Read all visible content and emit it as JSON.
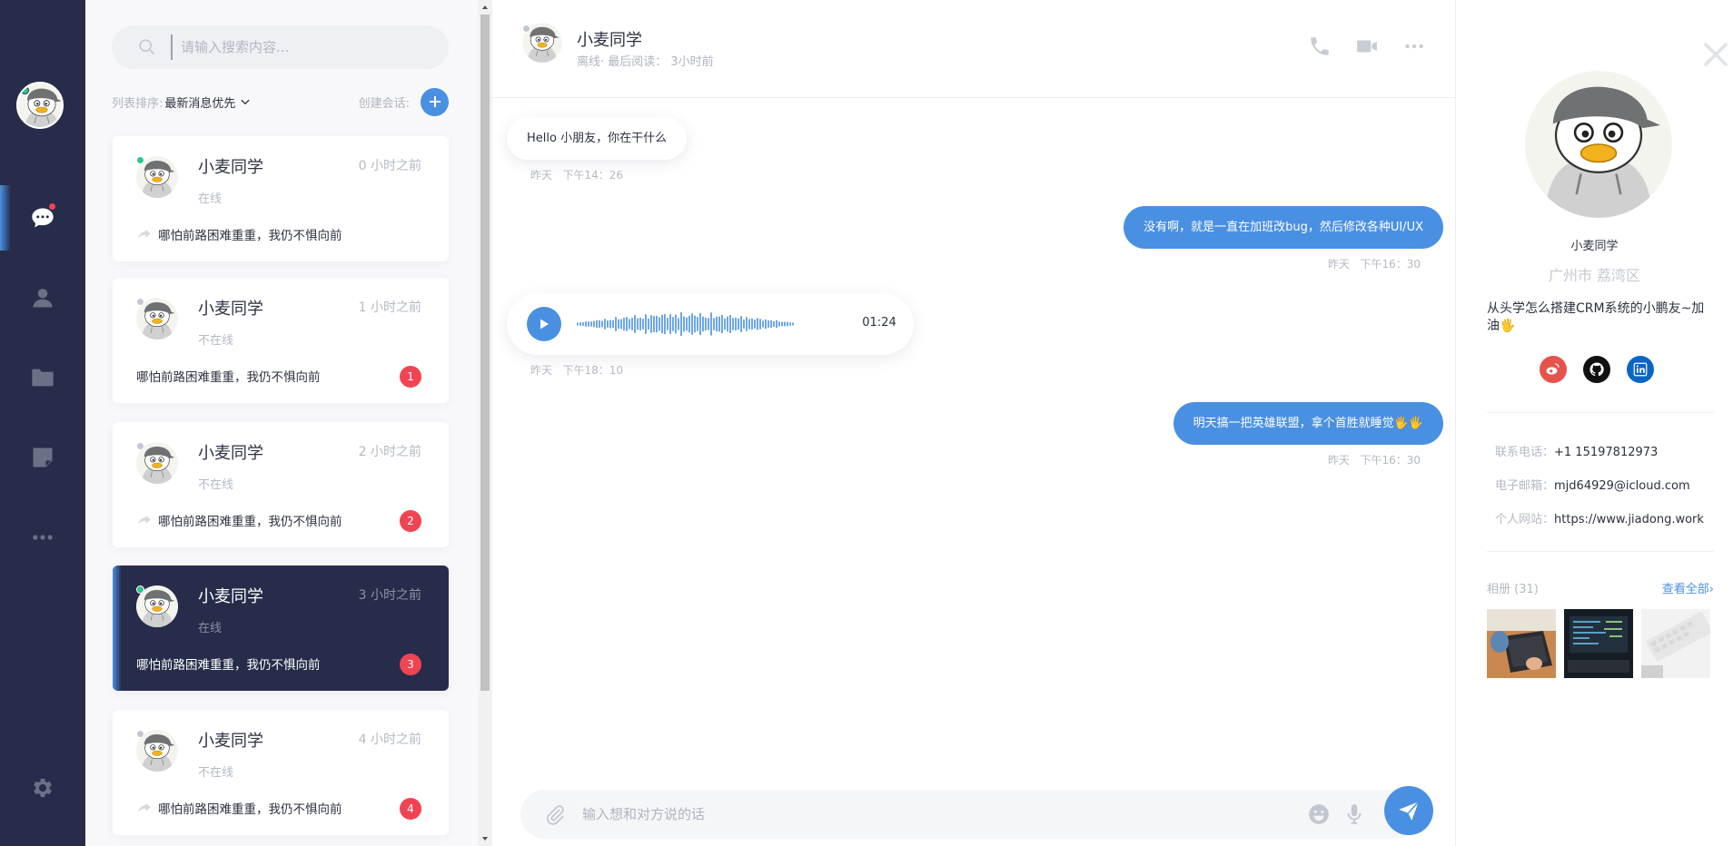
{
  "search": {
    "placeholder": "请输入搜索内容..."
  },
  "sort": {
    "label": "列表排序:",
    "value": "最新消息优先",
    "create_label": "创建会话:"
  },
  "sessions": [
    {
      "name": "小麦同学",
      "time": "0 小时之前",
      "status": "在线",
      "message": "哪怕前路困难重重，我仍不惧向前",
      "unread": "",
      "online": true,
      "forwarded": true
    },
    {
      "name": "小麦同学",
      "time": "1 小时之前",
      "status": "不在线",
      "message": "哪怕前路困难重重，我仍不惧向前",
      "unread": "1",
      "online": false,
      "forwarded": false
    },
    {
      "name": "小麦同学",
      "time": "2 小时之前",
      "status": "不在线",
      "message": "哪怕前路困难重重，我仍不惧向前",
      "unread": "2",
      "online": false,
      "forwarded": true
    },
    {
      "name": "小麦同学",
      "time": "3 小时之前",
      "status": "在线",
      "message": "哪怕前路困难重重，我仍不惧向前",
      "unread": "3",
      "online": true,
      "forwarded": false,
      "active": true
    },
    {
      "name": "小麦同学",
      "time": "4 小时之前",
      "status": "不在线",
      "message": "哪怕前路困难重重，我仍不惧向前",
      "unread": "4",
      "online": false,
      "forwarded": true
    }
  ],
  "chat": {
    "name": "小麦同学",
    "subtitle": "离线· 最后阅读： 3小时前",
    "messages": [
      {
        "text": "Hello 小朋友，你在干什么",
        "day": "昨天",
        "time": "下午14：26"
      },
      {
        "text": "没有啊，就是一直在加班改bug，然后修改各种UI/UX",
        "day": "昨天",
        "time": "下午16：30"
      },
      {
        "voice_duration": "01:24",
        "day": "昨天",
        "time": "下午18：10"
      },
      {
        "text": "明天搞一把英雄联盟，拿个首胜就睡觉🖐🖐",
        "day": "昨天",
        "time": "下午16：30"
      }
    ],
    "composer_placeholder": "输入想和对方说的话"
  },
  "profile": {
    "name": "小麦同学",
    "location": "广州市 荔湾区",
    "bio": "从头学怎么搭建CRM系统的小鹏友~加油🖐",
    "phone_label": "联系电话：",
    "phone": "+1 15197812973",
    "email_label": "电子邮箱：",
    "email": "mjd64929@icloud.com",
    "website_label": "个人网站：",
    "website": "https://www.jiadong.work",
    "album_title": "相册 (31)",
    "album_more": "查看全部›"
  },
  "colors": {
    "accent": "#4a90e2",
    "nav_bg": "#262c49",
    "badge": "#f04452",
    "online": "#31c48d",
    "weibo": "#e6534b",
    "github": "#111111",
    "linkedin": "#0a66c2"
  },
  "icons": {
    "nav": [
      "chat-icon",
      "contacts-icon",
      "folder-icon",
      "note-icon",
      "more-icon",
      "settings-icon"
    ],
    "header": [
      "phone-icon",
      "video-icon",
      "more-icon"
    ],
    "social": [
      "weibo-icon",
      "github-icon",
      "linkedin-icon"
    ]
  }
}
